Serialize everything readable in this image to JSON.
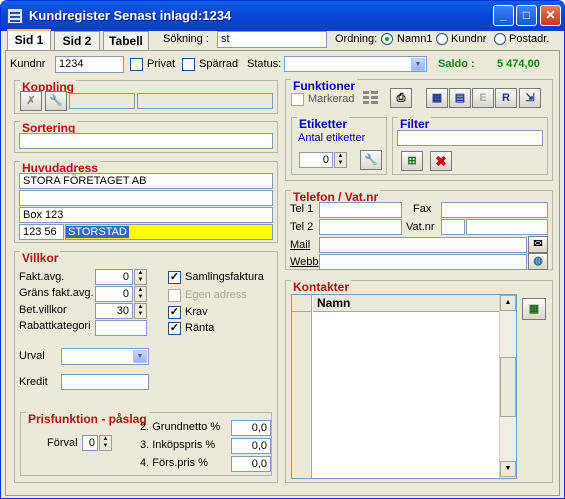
{
  "window": {
    "title": "Kundregister  Senast inlagd:1234"
  },
  "tabs": [
    {
      "label": "Sid 1"
    },
    {
      "label": "Sid 2"
    },
    {
      "label": "Tabell"
    }
  ],
  "search": {
    "label": "Sökning :",
    "value": "st"
  },
  "order": {
    "label": "Ordning:",
    "options": [
      {
        "label": "Namn1",
        "selected": true
      },
      {
        "label": "Kundnr",
        "selected": false
      },
      {
        "label": "Postadr.",
        "selected": false
      }
    ]
  },
  "customer": {
    "kundnr_label": "Kundnr",
    "kundnr": "1234",
    "privat_label": "Privat",
    "sparrad_label": "Spärrad",
    "status_label": "Status:",
    "status": "",
    "saldo_label": "Saldo :",
    "saldo": "5 474,00"
  },
  "koppling": {
    "title": "Koppling"
  },
  "sortering": {
    "title": "Sortering",
    "value": ""
  },
  "huvudadress": {
    "title": "Huvudadress",
    "line1": "STORA FÖRETAGET AB",
    "line2": "",
    "line3": "Box 123",
    "postnr": "123 56",
    "ort": "STORSTAD"
  },
  "villkor": {
    "title": "Villkor",
    "rows": [
      {
        "label": "Fakt.avg.",
        "value": "0"
      },
      {
        "label": "Gräns fakt.avg.",
        "value": "0"
      },
      {
        "label": "Bet.villkor",
        "value": "30"
      },
      {
        "label": "Rabattkategori",
        "value": ""
      }
    ],
    "checks": [
      {
        "label": "Samlingsfaktura",
        "checked": true,
        "disabled": false
      },
      {
        "label": "Egen adress",
        "checked": false,
        "disabled": true
      },
      {
        "label": "Krav",
        "checked": true,
        "disabled": false
      },
      {
        "label": "Ränta",
        "checked": true,
        "disabled": false
      }
    ],
    "urval_label": "Urval",
    "urval": "",
    "kredit_label": "Kredit",
    "kredit": ""
  },
  "prisfunktion": {
    "title": "Prisfunktion - påslag",
    "forval_label": "Förval",
    "forval": "0",
    "rows": [
      {
        "label": "2. Grundnetto %",
        "value": "0,0"
      },
      {
        "label": "3. Inköpspris %",
        "value": "0,0"
      },
      {
        "label": "4. Förs.pris %",
        "value": "0,0"
      }
    ]
  },
  "funktioner": {
    "title": "Funktioner",
    "markerad_label": "Markerad",
    "button_labels": [
      "E",
      "R"
    ]
  },
  "etiketter": {
    "title": "Etiketter",
    "subtitle": "Antal etiketter",
    "value": "0"
  },
  "filter": {
    "title": "Filter",
    "value": ""
  },
  "telefon": {
    "title": "Telefon / Vat.nr",
    "tel1_label": "Tel 1",
    "tel1": "",
    "tel2_label": "Tel 2",
    "tel2": "",
    "fax_label": "Fax",
    "fax": "",
    "vatnr_label": "Vat.nr",
    "vatnr": "",
    "mail_label": "Mail",
    "mail": "",
    "webb_label": "Webb",
    "webb": ""
  },
  "kontakter": {
    "title": "Kontakter",
    "column": "Namn",
    "rows": []
  },
  "colors": {
    "titlebar": "#0a5fe8",
    "saldo": "#0a8a0a",
    "section_title": "#b01010",
    "panel_title_blue": "#0000c0",
    "ort_highlight": "#ffff00",
    "ort_selection": "#316ac5"
  }
}
